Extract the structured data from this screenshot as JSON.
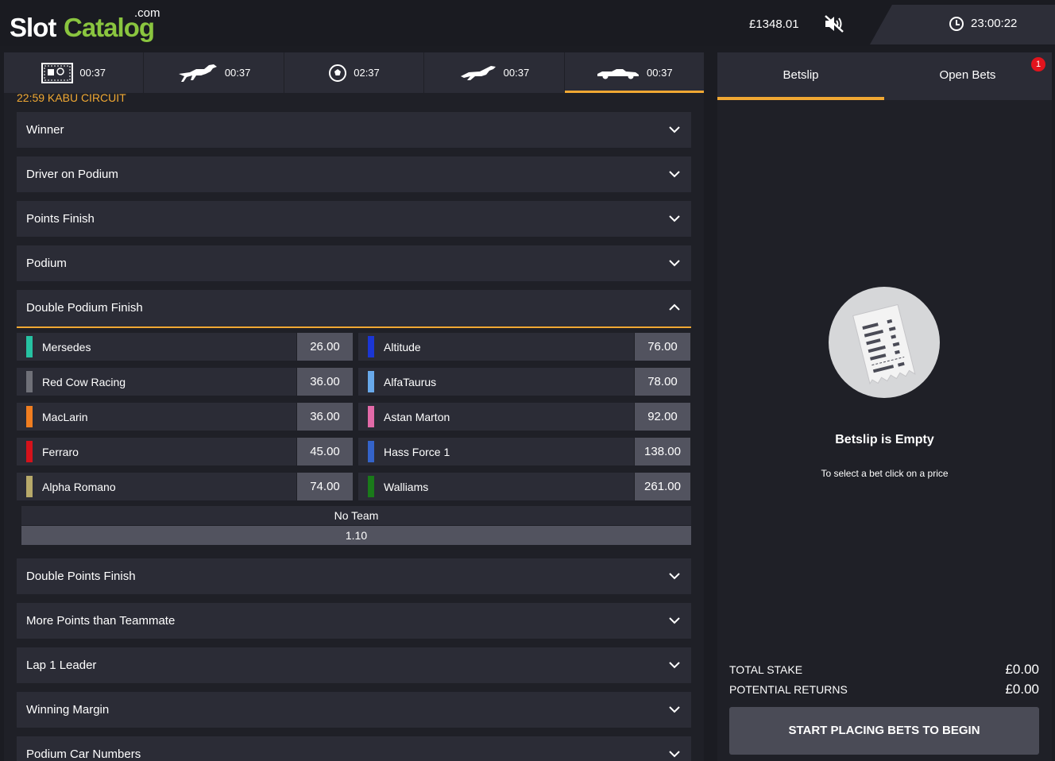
{
  "header": {
    "logo_slot": "Slot",
    "logo_catalog": "Catalog",
    "logo_com": ".com",
    "balance": "£1348.01",
    "clock": "23:00:22",
    "mute_icon": "speaker-muted-icon",
    "clock_icon": "clock-icon"
  },
  "sport_tabs": [
    {
      "icon": "penalty-goal-icon",
      "time": "00:37"
    },
    {
      "icon": "horse-racing-icon",
      "time": "00:37"
    },
    {
      "icon": "football-icon",
      "time": "02:37"
    },
    {
      "icon": "greyhound-icon",
      "time": "00:37"
    },
    {
      "icon": "racing-car-icon",
      "time": "00:37",
      "active": true
    }
  ],
  "event_title": "22:59 KABU CIRCUIT",
  "markets_top": [
    {
      "label": "Winner"
    },
    {
      "label": "Driver on Podium"
    },
    {
      "label": "Points Finish"
    },
    {
      "label": "Podium"
    },
    {
      "label": "Double Podium Finish",
      "open": true
    }
  ],
  "selections_left": [
    {
      "name": "Mersedes",
      "price": "26.00",
      "color": "#26c2a2"
    },
    {
      "name": "Red Cow Racing",
      "price": "36.00",
      "color": "#6f7078"
    },
    {
      "name": "MacLarin",
      "price": "36.00",
      "color": "#f07d20"
    },
    {
      "name": "Ferraro",
      "price": "45.00",
      "color": "#d4121b"
    },
    {
      "name": "Alpha Romano",
      "price": "74.00",
      "color": "#b7a96a"
    }
  ],
  "selections_right": [
    {
      "name": "Altitude",
      "price": "76.00",
      "color": "#1b36d4"
    },
    {
      "name": "AlfaTaurus",
      "price": "78.00",
      "color": "#68a9ea"
    },
    {
      "name": "Astan Marton",
      "price": "92.00",
      "color": "#e26aa8"
    },
    {
      "name": "Hass Force 1",
      "price": "138.00",
      "color": "#3463c9"
    },
    {
      "name": "Walliams",
      "price": "261.00",
      "color": "#1a7a1a"
    }
  ],
  "no_team": {
    "label": "No Team",
    "price": "1.10"
  },
  "markets_bottom": [
    {
      "label": "Double Points Finish"
    },
    {
      "label": "More Points than Teammate"
    },
    {
      "label": "Lap 1 Leader"
    },
    {
      "label": "Winning Margin"
    },
    {
      "label": "Podium Car Numbers"
    }
  ],
  "betslip": {
    "tab_betslip": "Betslip",
    "tab_open_bets": "Open Bets",
    "open_bets_count": "1",
    "empty_title": "Betslip is Empty",
    "empty_sub": "To select a bet click on a price",
    "total_stake_label": "TOTAL STAKE",
    "total_stake_value": "£0.00",
    "potential_returns_label": "POTENTIAL RETURNS",
    "potential_returns_value": "£0.00",
    "start_button": "START PLACING BETS TO BEGIN"
  },
  "colors": {
    "accent": "#f0a833",
    "brand_green": "#8ac53f",
    "badge_red": "#e2141d"
  }
}
